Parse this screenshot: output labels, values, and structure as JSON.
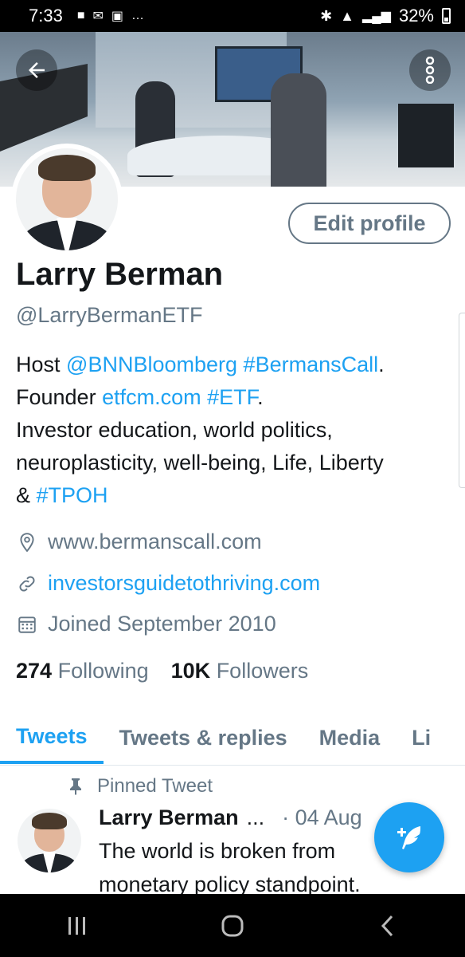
{
  "status_bar": {
    "time": "7:33",
    "notification_icons": [
      "screen-mirror-icon",
      "mail-icon",
      "image-icon"
    ],
    "more": "…",
    "battery": "32%"
  },
  "profile": {
    "name": "Larry Berman",
    "handle": "@LarryBermanETF",
    "edit_label": "Edit profile",
    "bio": {
      "line1_prefix": "Host ",
      "mention": "@BNNBloomberg",
      "hashtag1": "#BermansCall",
      "line1_suffix": ".",
      "line2_prefix": "Founder ",
      "site": "etfcm.com",
      "hashtag2": "#ETF",
      "line2_suffix": ".",
      "line3": "Investor education, world politics,",
      "line4": "neuroplasticity, well-being, Life, Liberty",
      "line5_prefix": "& ",
      "hashtag3": "#TPOH"
    },
    "location": "www.bermanscall.com",
    "website": "investorsguidetothriving.com",
    "joined": "Joined September 2010",
    "following_count": "274",
    "following_label": "Following",
    "followers_count": "10K",
    "followers_label": "Followers"
  },
  "tabs": [
    {
      "label": "Tweets",
      "active": true
    },
    {
      "label": "Tweets & replies",
      "active": false
    },
    {
      "label": "Media",
      "active": false
    },
    {
      "label": "Li",
      "active": false
    }
  ],
  "pinned_tweet": {
    "pinned_label": "Pinned Tweet",
    "author": "Larry Berman",
    "ellipsis": "...",
    "date": "· 04 Aug",
    "text_line1": "The world is broken from",
    "text_line2": "monetary policy standpoint."
  },
  "colors": {
    "accent": "#1da1f2",
    "secondary_text": "#657786",
    "primary_text": "#14171a"
  }
}
